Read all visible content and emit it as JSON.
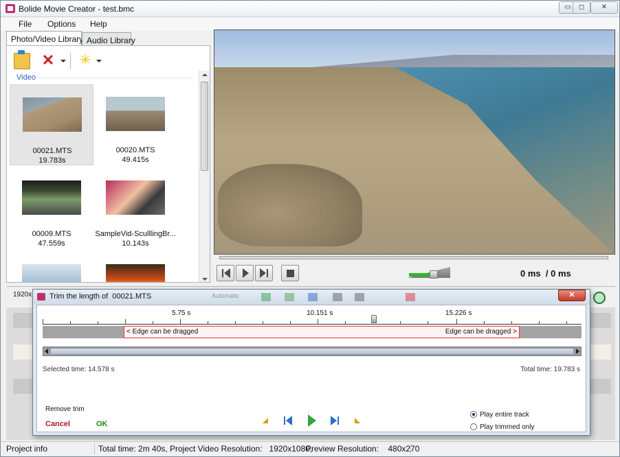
{
  "window": {
    "title": "Bolide Movie Creator - test.bmc",
    "min_glyph": "▭",
    "max_glyph": "◻",
    "close_glyph": "✕"
  },
  "menu": [
    "File",
    "Options",
    "Help"
  ],
  "library": {
    "tabs": [
      "Photo/Video Library",
      "Audio Library"
    ],
    "group_label": "Video",
    "items": [
      {
        "name": "00021.MTS",
        "duration": "19.783s",
        "selected": true
      },
      {
        "name": "00020.MTS",
        "duration": "49.415s",
        "selected": false
      },
      {
        "name": "00009.MTS",
        "duration": "47.559s",
        "selected": false
      },
      {
        "name": "SampleVid-SculllingBr...",
        "duration": "10.143s",
        "selected": false
      }
    ]
  },
  "player": {
    "time_current": "0 ms",
    "time_total": "/ 0 ms",
    "volume": 0.62
  },
  "timeline": {
    "resolution_stub": "1920x"
  },
  "trim_dialog": {
    "title": "Trim the length of  00021.MTS",
    "ghost_toolbar_text": "Automatic",
    "close_glyph": "✕",
    "ruler_labels": [
      "5.75 s",
      "10.151 s",
      "15.226 s"
    ],
    "edge_left": "< Edge can be dragged",
    "edge_right": "Edge can be dragged >",
    "selected_time": "Selected time: 14.578 s",
    "total_time": "Total time: 19.783 s",
    "remove_trim": "Remove trim",
    "cancel": "Cancel",
    "ok": "OK",
    "play_options": [
      {
        "label": "Play entire track",
        "checked": true
      },
      {
        "label": "Play trimmed only",
        "checked": false
      }
    ]
  },
  "statusbar": {
    "project_info": "Project info",
    "total_time": "Total time: 2m 40s,",
    "project_resolution": "Project Video Resolution:   1920x1080,",
    "preview_resolution": "Preview Resolution:    480x270"
  }
}
